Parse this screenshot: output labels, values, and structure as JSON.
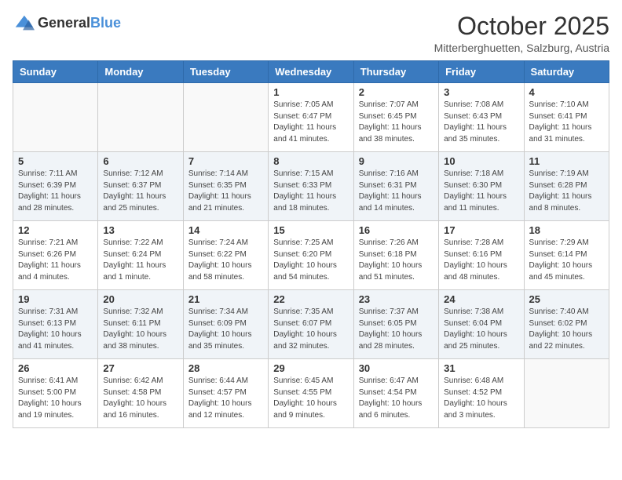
{
  "logo": {
    "general": "General",
    "blue": "Blue"
  },
  "header": {
    "month": "October 2025",
    "location": "Mitterberghuetten, Salzburg, Austria"
  },
  "weekdays": [
    "Sunday",
    "Monday",
    "Tuesday",
    "Wednesday",
    "Thursday",
    "Friday",
    "Saturday"
  ],
  "weeks": [
    [
      {
        "day": "",
        "info": ""
      },
      {
        "day": "",
        "info": ""
      },
      {
        "day": "",
        "info": ""
      },
      {
        "day": "1",
        "info": "Sunrise: 7:05 AM\nSunset: 6:47 PM\nDaylight: 11 hours\nand 41 minutes."
      },
      {
        "day": "2",
        "info": "Sunrise: 7:07 AM\nSunset: 6:45 PM\nDaylight: 11 hours\nand 38 minutes."
      },
      {
        "day": "3",
        "info": "Sunrise: 7:08 AM\nSunset: 6:43 PM\nDaylight: 11 hours\nand 35 minutes."
      },
      {
        "day": "4",
        "info": "Sunrise: 7:10 AM\nSunset: 6:41 PM\nDaylight: 11 hours\nand 31 minutes."
      }
    ],
    [
      {
        "day": "5",
        "info": "Sunrise: 7:11 AM\nSunset: 6:39 PM\nDaylight: 11 hours\nand 28 minutes."
      },
      {
        "day": "6",
        "info": "Sunrise: 7:12 AM\nSunset: 6:37 PM\nDaylight: 11 hours\nand 25 minutes."
      },
      {
        "day": "7",
        "info": "Sunrise: 7:14 AM\nSunset: 6:35 PM\nDaylight: 11 hours\nand 21 minutes."
      },
      {
        "day": "8",
        "info": "Sunrise: 7:15 AM\nSunset: 6:33 PM\nDaylight: 11 hours\nand 18 minutes."
      },
      {
        "day": "9",
        "info": "Sunrise: 7:16 AM\nSunset: 6:31 PM\nDaylight: 11 hours\nand 14 minutes."
      },
      {
        "day": "10",
        "info": "Sunrise: 7:18 AM\nSunset: 6:30 PM\nDaylight: 11 hours\nand 11 minutes."
      },
      {
        "day": "11",
        "info": "Sunrise: 7:19 AM\nSunset: 6:28 PM\nDaylight: 11 hours\nand 8 minutes."
      }
    ],
    [
      {
        "day": "12",
        "info": "Sunrise: 7:21 AM\nSunset: 6:26 PM\nDaylight: 11 hours\nand 4 minutes."
      },
      {
        "day": "13",
        "info": "Sunrise: 7:22 AM\nSunset: 6:24 PM\nDaylight: 11 hours\nand 1 minute."
      },
      {
        "day": "14",
        "info": "Sunrise: 7:24 AM\nSunset: 6:22 PM\nDaylight: 10 hours\nand 58 minutes."
      },
      {
        "day": "15",
        "info": "Sunrise: 7:25 AM\nSunset: 6:20 PM\nDaylight: 10 hours\nand 54 minutes."
      },
      {
        "day": "16",
        "info": "Sunrise: 7:26 AM\nSunset: 6:18 PM\nDaylight: 10 hours\nand 51 minutes."
      },
      {
        "day": "17",
        "info": "Sunrise: 7:28 AM\nSunset: 6:16 PM\nDaylight: 10 hours\nand 48 minutes."
      },
      {
        "day": "18",
        "info": "Sunrise: 7:29 AM\nSunset: 6:14 PM\nDaylight: 10 hours\nand 45 minutes."
      }
    ],
    [
      {
        "day": "19",
        "info": "Sunrise: 7:31 AM\nSunset: 6:13 PM\nDaylight: 10 hours\nand 41 minutes."
      },
      {
        "day": "20",
        "info": "Sunrise: 7:32 AM\nSunset: 6:11 PM\nDaylight: 10 hours\nand 38 minutes."
      },
      {
        "day": "21",
        "info": "Sunrise: 7:34 AM\nSunset: 6:09 PM\nDaylight: 10 hours\nand 35 minutes."
      },
      {
        "day": "22",
        "info": "Sunrise: 7:35 AM\nSunset: 6:07 PM\nDaylight: 10 hours\nand 32 minutes."
      },
      {
        "day": "23",
        "info": "Sunrise: 7:37 AM\nSunset: 6:05 PM\nDaylight: 10 hours\nand 28 minutes."
      },
      {
        "day": "24",
        "info": "Sunrise: 7:38 AM\nSunset: 6:04 PM\nDaylight: 10 hours\nand 25 minutes."
      },
      {
        "day": "25",
        "info": "Sunrise: 7:40 AM\nSunset: 6:02 PM\nDaylight: 10 hours\nand 22 minutes."
      }
    ],
    [
      {
        "day": "26",
        "info": "Sunrise: 6:41 AM\nSunset: 5:00 PM\nDaylight: 10 hours\nand 19 minutes."
      },
      {
        "day": "27",
        "info": "Sunrise: 6:42 AM\nSunset: 4:58 PM\nDaylight: 10 hours\nand 16 minutes."
      },
      {
        "day": "28",
        "info": "Sunrise: 6:44 AM\nSunset: 4:57 PM\nDaylight: 10 hours\nand 12 minutes."
      },
      {
        "day": "29",
        "info": "Sunrise: 6:45 AM\nSunset: 4:55 PM\nDaylight: 10 hours\nand 9 minutes."
      },
      {
        "day": "30",
        "info": "Sunrise: 6:47 AM\nSunset: 4:54 PM\nDaylight: 10 hours\nand 6 minutes."
      },
      {
        "day": "31",
        "info": "Sunrise: 6:48 AM\nSunset: 4:52 PM\nDaylight: 10 hours\nand 3 minutes."
      },
      {
        "day": "",
        "info": ""
      }
    ]
  ]
}
